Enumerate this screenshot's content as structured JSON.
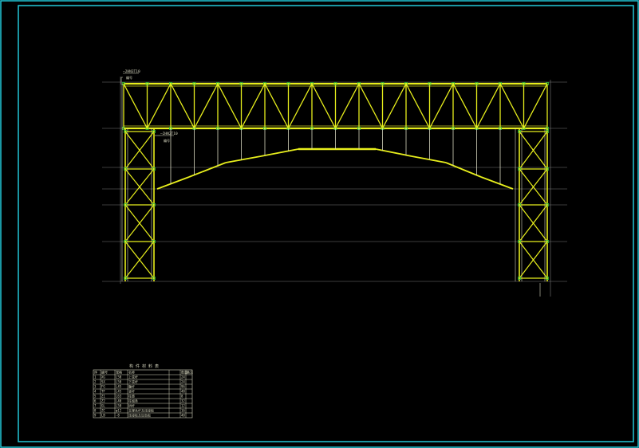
{
  "drawing": {
    "background": "#000000",
    "frame_color": "#22c8d8",
    "structure_color": "#e8ef1c",
    "secondary_color": "#c8cc22",
    "member_color": "#d8d8c0",
    "node_color": "#2fbf3a",
    "grid_color": "#7a7a7a"
  },
  "annotations": {
    "leader_top": "—2HN3T10",
    "leader_top_sub": "编号",
    "leader_mid": "—2HN2T10",
    "leader_mid_sub": "编号"
  },
  "schedule": {
    "title": "构 件 材 料 表",
    "headers": [
      "序",
      "编号",
      "规格",
      "名称",
      "",
      "数量",
      "备注"
    ],
    "rows": [
      [
        "1",
        "XG",
        "L50",
        "上弦杆",
        "",
        "24",
        ""
      ],
      [
        "2",
        "SX",
        "L50",
        "下弦杆",
        "",
        "24",
        ""
      ],
      [
        "3",
        "FG",
        "L45",
        "腹杆",
        "",
        "96",
        ""
      ],
      [
        "4",
        "TF",
        "L45",
        "竖杆",
        "",
        "48",
        ""
      ],
      [
        "5",
        "Z1",
        "L63",
        "柱肢",
        "",
        "8",
        ""
      ],
      [
        "6",
        "Z2",
        "L40",
        "柱缀条",
        "",
        "32",
        ""
      ],
      [
        "7",
        "GL",
        "L50",
        "拱杆",
        "",
        "12",
        ""
      ],
      [
        "8",
        "ZC",
        "φ12",
        "支撑系杆及连接板",
        "",
        "16",
        ""
      ],
      [
        "9",
        "LB",
        "-8",
        "连接板及加劲板",
        "",
        "40",
        ""
      ]
    ]
  }
}
